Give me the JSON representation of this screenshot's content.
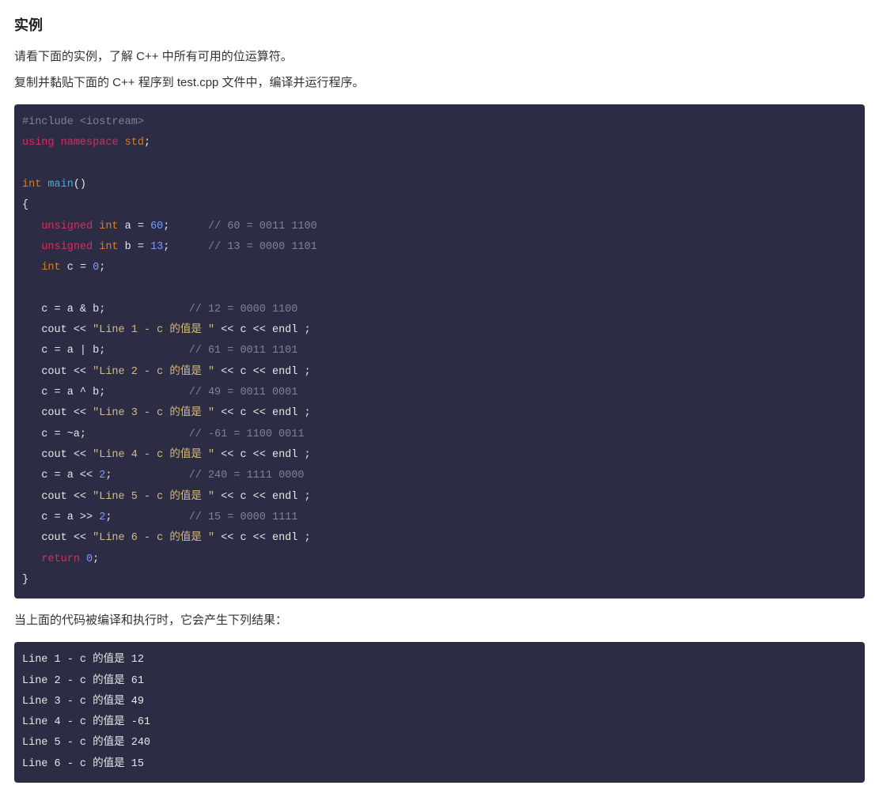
{
  "heading": "实例",
  "intro_lines": [
    "请看下面的实例，了解 C++ 中所有可用的位运算符。",
    "复制并黏贴下面的 C++ 程序到 test.cpp 文件中，编译并运行程序。"
  ],
  "code": {
    "tokens": [
      [
        [
          "comment",
          "#include <iostream>"
        ]
      ],
      [
        [
          "keyword",
          "using"
        ],
        [
          "punct",
          " "
        ],
        [
          "keyword",
          "namespace"
        ],
        [
          "punct",
          " "
        ],
        [
          "type",
          "std"
        ],
        [
          "punct",
          ";"
        ]
      ],
      [],
      [
        [
          "type",
          "int"
        ],
        [
          "punct",
          " "
        ],
        [
          "func",
          "main"
        ],
        [
          "punct",
          "()"
        ]
      ],
      [
        [
          "punct",
          "{"
        ]
      ],
      [
        [
          "punct",
          "   "
        ],
        [
          "keyword",
          "unsigned"
        ],
        [
          "punct",
          " "
        ],
        [
          "type",
          "int"
        ],
        [
          "punct",
          " "
        ],
        [
          "name",
          "a"
        ],
        [
          "punct",
          " = "
        ],
        [
          "num",
          "60"
        ],
        [
          "punct",
          ";      "
        ],
        [
          "comment",
          "// 60 = 0011 1100"
        ]
      ],
      [
        [
          "punct",
          "   "
        ],
        [
          "keyword",
          "unsigned"
        ],
        [
          "punct",
          " "
        ],
        [
          "type",
          "int"
        ],
        [
          "punct",
          " "
        ],
        [
          "name",
          "b"
        ],
        [
          "punct",
          " = "
        ],
        [
          "num",
          "13"
        ],
        [
          "punct",
          ";      "
        ],
        [
          "comment",
          "// 13 = 0000 1101"
        ]
      ],
      [
        [
          "punct",
          "   "
        ],
        [
          "type",
          "int"
        ],
        [
          "punct",
          " "
        ],
        [
          "name",
          "c"
        ],
        [
          "punct",
          " = "
        ],
        [
          "num",
          "0"
        ],
        [
          "punct",
          ";"
        ]
      ],
      [],
      [
        [
          "punct",
          "   c = a & b;             "
        ],
        [
          "comment",
          "// 12 = 0000 1100"
        ]
      ],
      [
        [
          "punct",
          "   "
        ],
        [
          "name",
          "cout"
        ],
        [
          "punct",
          " << "
        ],
        [
          "str",
          "\"Line 1 - c 的值是 \""
        ],
        [
          "punct",
          " << c << "
        ],
        [
          "const",
          "endl"
        ],
        [
          "punct",
          " ;"
        ]
      ],
      [
        [
          "punct",
          "   c = a | b;             "
        ],
        [
          "comment",
          "// 61 = 0011 1101"
        ]
      ],
      [
        [
          "punct",
          "   "
        ],
        [
          "name",
          "cout"
        ],
        [
          "punct",
          " << "
        ],
        [
          "str",
          "\"Line 2 - c 的值是 \""
        ],
        [
          "punct",
          " << c << "
        ],
        [
          "const",
          "endl"
        ],
        [
          "punct",
          " ;"
        ]
      ],
      [
        [
          "punct",
          "   c = a ^ b;             "
        ],
        [
          "comment",
          "// 49 = 0011 0001"
        ]
      ],
      [
        [
          "punct",
          "   "
        ],
        [
          "name",
          "cout"
        ],
        [
          "punct",
          " << "
        ],
        [
          "str",
          "\"Line 3 - c 的值是 \""
        ],
        [
          "punct",
          " << c << "
        ],
        [
          "const",
          "endl"
        ],
        [
          "punct",
          " ;"
        ]
      ],
      [
        [
          "punct",
          "   c = ~a;                "
        ],
        [
          "comment",
          "// -61 = 1100 0011"
        ]
      ],
      [
        [
          "punct",
          "   "
        ],
        [
          "name",
          "cout"
        ],
        [
          "punct",
          " << "
        ],
        [
          "str",
          "\"Line 4 - c 的值是 \""
        ],
        [
          "punct",
          " << c << "
        ],
        [
          "const",
          "endl"
        ],
        [
          "punct",
          " ;"
        ]
      ],
      [
        [
          "punct",
          "   c = a << "
        ],
        [
          "num",
          "2"
        ],
        [
          "punct",
          ";            "
        ],
        [
          "comment",
          "// 240 = 1111 0000"
        ]
      ],
      [
        [
          "punct",
          "   "
        ],
        [
          "name",
          "cout"
        ],
        [
          "punct",
          " << "
        ],
        [
          "str",
          "\"Line 5 - c 的值是 \""
        ],
        [
          "punct",
          " << c << "
        ],
        [
          "const",
          "endl"
        ],
        [
          "punct",
          " ;"
        ]
      ],
      [
        [
          "punct",
          "   c = a >> "
        ],
        [
          "num",
          "2"
        ],
        [
          "punct",
          ";            "
        ],
        [
          "comment",
          "// 15 = 0000 1111"
        ]
      ],
      [
        [
          "punct",
          "   "
        ],
        [
          "name",
          "cout"
        ],
        [
          "punct",
          " << "
        ],
        [
          "str",
          "\"Line 6 - c 的值是 \""
        ],
        [
          "punct",
          " << c << "
        ],
        [
          "const",
          "endl"
        ],
        [
          "punct",
          " ;"
        ]
      ],
      [
        [
          "punct",
          "   "
        ],
        [
          "keyword",
          "return"
        ],
        [
          "punct",
          " "
        ],
        [
          "num",
          "0"
        ],
        [
          "punct",
          ";"
        ]
      ],
      [
        [
          "punct",
          "}"
        ]
      ]
    ]
  },
  "after_code_text": "当上面的代码被编译和执行时，它会产生下列结果：",
  "output_lines": [
    "Line 1 - c 的值是 12",
    "Line 2 - c 的值是 61",
    "Line 3 - c 的值是 49",
    "Line 4 - c 的值是 -61",
    "Line 5 - c 的值是 240",
    "Line 6 - c 的值是 15"
  ],
  "token_class_map": {
    "comment": "tok-comment",
    "keyword": "tok-keyword",
    "keyword2": "tok-keyword2",
    "type": "tok-type",
    "name": "tok-name",
    "func": "tok-func",
    "num": "tok-num",
    "str": "tok-str",
    "punct": "tok-punct",
    "op": "tok-op",
    "const": "tok-const"
  }
}
